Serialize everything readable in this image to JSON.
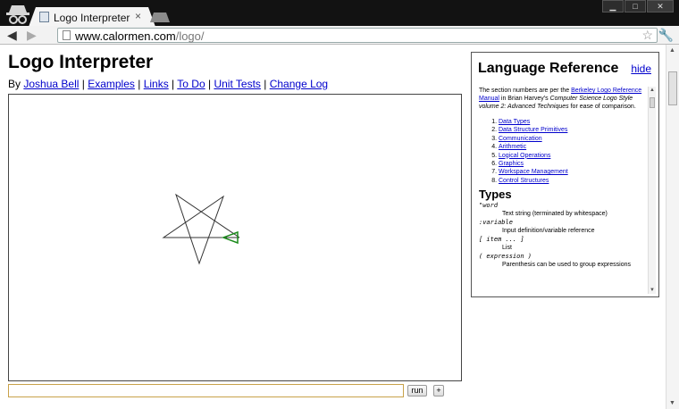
{
  "browser": {
    "tab_title": "Logo Interpreter",
    "tab_close": "×",
    "url_host": "www.calormen.com",
    "url_path": "/logo/",
    "window_buttons": [
      "▁",
      "□",
      "✕"
    ]
  },
  "page": {
    "title": "Logo Interpreter",
    "by_label": "By",
    "nav_links": [
      "Joshua Bell",
      "Examples",
      "Links",
      "To Do",
      "Unit Tests",
      "Change Log"
    ],
    "separator": " | "
  },
  "command": {
    "value": "",
    "run_label": "run",
    "expand_label": "+"
  },
  "reference": {
    "heading": "Language Reference",
    "hide_label": "hide",
    "intro_1": "The section numbers are per the ",
    "intro_link": "Berkeley Logo Reference Manual",
    "intro_2": " in Brian Harvey's ",
    "intro_book": "Computer Science Logo Style volume 2: Advanced Techniques",
    "intro_3": " for ease of comparison.",
    "sections": [
      "Data Types",
      "Data Structure Primitives",
      "Communication",
      "Arithmetic",
      "Logical Operations",
      "Graphics",
      "Workspace Management",
      "Control Structures"
    ],
    "types_heading": "Types",
    "types": [
      {
        "term": "\"word",
        "desc": "Text string (terminated by whitespace)"
      },
      {
        "term": ":variable",
        "desc": "Input definition/variable reference"
      },
      {
        "term": "[ item ... ]",
        "desc": "List"
      },
      {
        "term": "( expression )",
        "desc": "Parenthesis can be used to group expressions"
      }
    ]
  },
  "colors": {
    "link": "#0000cc",
    "turtle": "#1a8a1a",
    "drawing": "#333333",
    "input_border": "#c8a24a"
  },
  "icons": [
    "incognito-icon",
    "favicon-icon",
    "back-icon",
    "forward-icon",
    "page-icon",
    "star-icon",
    "wrench-icon",
    "turtle-icon"
  ]
}
